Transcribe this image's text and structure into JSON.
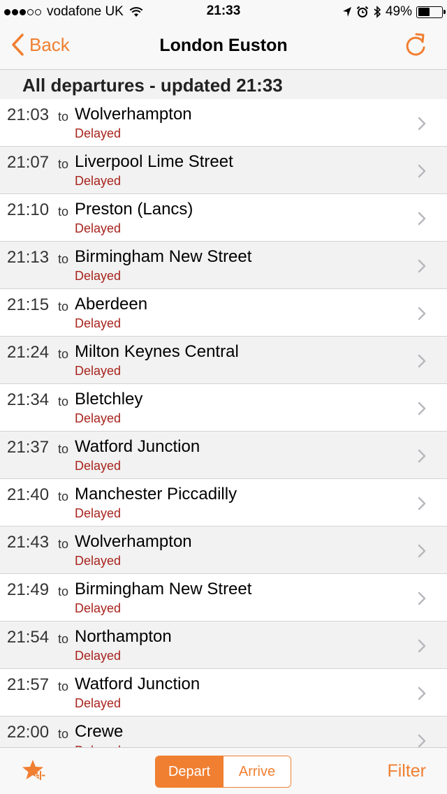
{
  "status_bar": {
    "carrier": "vodafone UK",
    "time": "21:33",
    "battery": "49%",
    "battery_level": 0.49,
    "signal_bars_filled": 3,
    "signal_bars_total": 5,
    "icons": [
      "wifi-icon",
      "location-arrow-icon",
      "alarm-icon",
      "bluetooth-icon",
      "battery-icon"
    ]
  },
  "nav": {
    "back_label": "Back",
    "title": "London Euston",
    "refresh_icon": "refresh-icon"
  },
  "section_header": "All departures - updated 21:33",
  "departures": [
    {
      "time": "21:03",
      "to": "to",
      "destination": "Wolverhampton",
      "status": "Delayed"
    },
    {
      "time": "21:07",
      "to": "to",
      "destination": "Liverpool Lime Street",
      "status": "Delayed"
    },
    {
      "time": "21:10",
      "to": "to",
      "destination": "Preston (Lancs)",
      "status": "Delayed"
    },
    {
      "time": "21:13",
      "to": "to",
      "destination": "Birmingham New Street",
      "status": "Delayed"
    },
    {
      "time": "21:15",
      "to": "to",
      "destination": "Aberdeen",
      "status": "Delayed"
    },
    {
      "time": "21:24",
      "to": "to",
      "destination": "Milton Keynes Central",
      "status": "Delayed"
    },
    {
      "time": "21:34",
      "to": "to",
      "destination": "Bletchley",
      "status": "Delayed"
    },
    {
      "time": "21:37",
      "to": "to",
      "destination": "Watford Junction",
      "status": "Delayed"
    },
    {
      "time": "21:40",
      "to": "to",
      "destination": "Manchester Piccadilly",
      "status": "Delayed"
    },
    {
      "time": "21:43",
      "to": "to",
      "destination": "Wolverhampton",
      "status": "Delayed"
    },
    {
      "time": "21:49",
      "to": "to",
      "destination": "Birmingham New Street",
      "status": "Delayed"
    },
    {
      "time": "21:54",
      "to": "to",
      "destination": "Northampton",
      "status": "Delayed"
    },
    {
      "time": "21:57",
      "to": "to",
      "destination": "Watford Junction",
      "status": "Delayed"
    },
    {
      "time": "22:00",
      "to": "to",
      "destination": "Crewe",
      "status": "Delayed"
    }
  ],
  "toolbar": {
    "favourite_icon": "star-add-icon",
    "depart_label": "Depart",
    "arrive_label": "Arrive",
    "selected": "Depart",
    "filter_label": "Filter"
  },
  "colors": {
    "accent": "#f07f31",
    "delayed": "#a8231d",
    "row_alt": "#f2f2f2"
  }
}
